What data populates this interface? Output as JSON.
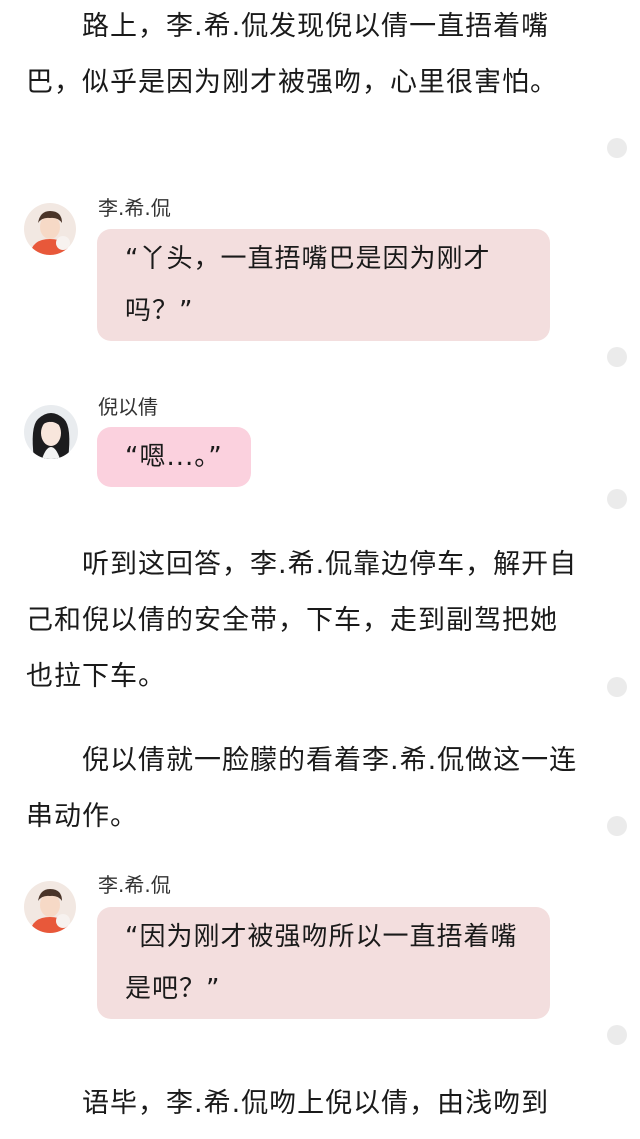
{
  "paragraphs": [
    "路上，李.希.侃发现倪以倩一直捂着嘴巴，似乎是因为刚才被强吻，心里很害怕。",
    "听到这回答，李.希.侃靠边停车，解开自己和倪以倩的安全带，下车，走到副驾把她也拉下车。",
    "倪以倩就一脸朦的看着李.希.侃做这一连串动作。",
    "语毕，李.希.侃吻上倪以倩，由浅吻到"
  ],
  "messages": [
    {
      "sender": "李.希.侃",
      "text": "“丫头，一直捂嘴巴是因为刚才吗？”"
    },
    {
      "sender": "倪以倩",
      "text": "“嗯...。”"
    },
    {
      "sender": "李.希.侃",
      "text": "“因为刚才被强吻所以一直捂着嘴是吧？”"
    }
  ],
  "colors": {
    "male_bubble": "#f3dede",
    "female_bubble": "#fbd1de",
    "side_dot": "#ebebeb"
  }
}
